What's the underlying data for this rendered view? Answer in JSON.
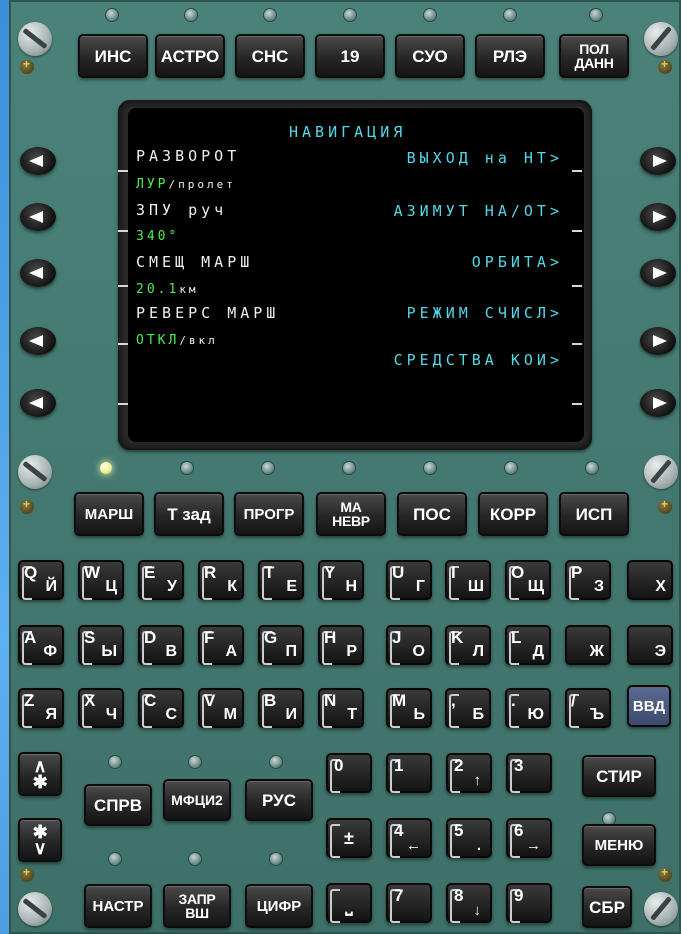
{
  "top_keys": [
    "ИНС",
    "АСТРО",
    "СНС",
    "19",
    "СУО",
    "РЛЭ",
    "ПОЛ\nДАНН"
  ],
  "mid_keys": [
    "МАРШ",
    "Т зад",
    "ПРОГР",
    "МА\nНЕВР",
    "ПОС",
    "КОРР",
    "ИСП"
  ],
  "screen": {
    "title": "НАВИГАЦИЯ",
    "left": [
      {
        "label": "РАЗВОРОТ",
        "val_green": "ЛУР",
        "val_sep": "/",
        "val_white": "пролет"
      },
      {
        "label": "ЗПУ руч",
        "val_green": "340°",
        "val_sep": "",
        "val_white": ""
      },
      {
        "label": "СМЕЩ МАРШ",
        "val_green": "20.1",
        "val_sep": "",
        "val_white": "км"
      },
      {
        "label": "РЕВЕРС МАРШ",
        "val_green": "ОТКЛ",
        "val_sep": "/",
        "val_white": "вкл"
      }
    ],
    "right": [
      "ВЫХОД на НТ>",
      "АЗИМУТ НА/ОТ>",
      "ОРБИТА>",
      "РЕЖИМ СЧИСЛ>",
      "СРЕДСТВА КОИ>"
    ]
  },
  "alpha_rows": [
    [
      [
        "Q",
        "Й"
      ],
      [
        "W",
        "Ц"
      ],
      [
        "E",
        "У"
      ],
      [
        "R",
        "К"
      ],
      [
        "T",
        "Е"
      ],
      [
        "Y",
        "Н"
      ],
      [
        "U",
        "Г"
      ],
      [
        "I",
        "Ш"
      ],
      [
        "O",
        "Щ"
      ],
      [
        "P",
        "З"
      ],
      [
        "",
        "Х"
      ]
    ],
    [
      [
        "A",
        "Ф"
      ],
      [
        "S",
        "Ы"
      ],
      [
        "D",
        "В"
      ],
      [
        "F",
        "А"
      ],
      [
        "G",
        "П"
      ],
      [
        "H",
        "Р"
      ],
      [
        "J",
        "О"
      ],
      [
        "K",
        "Л"
      ],
      [
        "L",
        "Д"
      ],
      [
        "",
        "Ж"
      ],
      [
        "",
        "Э"
      ]
    ],
    [
      [
        "Z",
        "Я"
      ],
      [
        "X",
        "Ч"
      ],
      [
        "C",
        "С"
      ],
      [
        "V",
        "М"
      ],
      [
        "B",
        "И"
      ],
      [
        "N",
        "Т"
      ],
      [
        "M",
        "Ь"
      ],
      [
        ",",
        "Б"
      ],
      [
        ".",
        "Ю"
      ],
      [
        "/",
        "Ъ"
      ]
    ]
  ],
  "vvd_label": "ВВД",
  "bottom": {
    "up_star": "∧\n✱",
    "down_star": "✱\n∨",
    "sprv": "СПРВ",
    "mfci2": "МФЦИ2",
    "rus": "РУС",
    "nastr": "НАСТР",
    "zapr": "ЗАПР\nВШ",
    "cifr": "ЦИФР",
    "stir": "СТИР",
    "menu": "МЕНЮ",
    "sbr": "СБР",
    "plusminus": "±",
    "space": "⎵",
    "digits": [
      [
        "0",
        ""
      ],
      [
        "1",
        ""
      ],
      [
        "2",
        "↑"
      ],
      [
        "3",
        ""
      ],
      [
        "4",
        "←"
      ],
      [
        "5",
        "."
      ],
      [
        "6",
        "→"
      ],
      [
        "7",
        ""
      ],
      [
        "8",
        "↓"
      ],
      [
        "9",
        ""
      ]
    ]
  }
}
